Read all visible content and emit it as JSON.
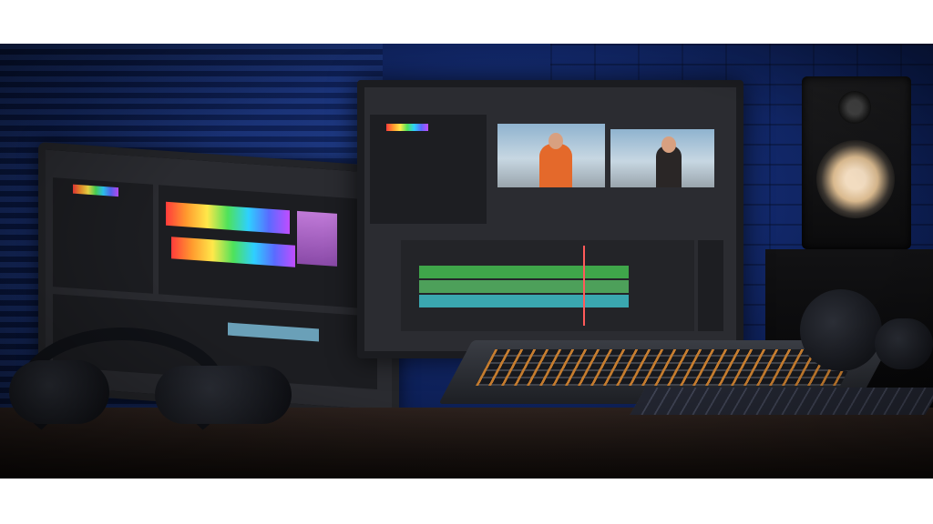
{
  "scene": {
    "description_tags": [
      "laptop",
      "monitor",
      "speaker",
      "headphones",
      "mixing-console",
      "keyboard"
    ],
    "colors": {
      "wall": "#12286a",
      "desk": "#2c211d",
      "accent_orange": "#e4692b",
      "spectrum_start": "#ff3b3b",
      "spectrum_end": "#c04dff"
    }
  }
}
